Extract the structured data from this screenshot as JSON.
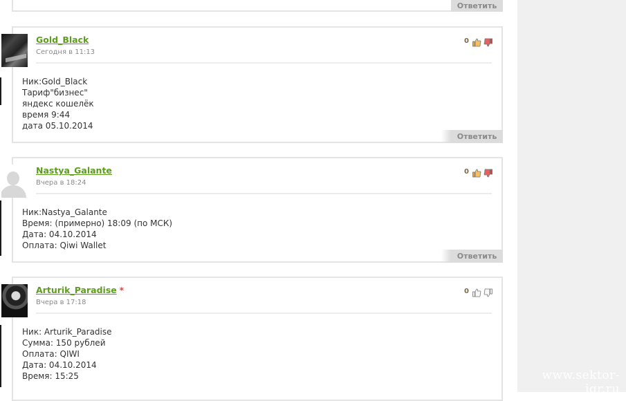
{
  "watermark": "www.sektor-igr.ru",
  "top_partial": {
    "reply_label": "Ответить"
  },
  "comments": [
    {
      "author": "Gold_Black",
      "time": "Сегодня в 11:13",
      "rating": "0",
      "has_star": false,
      "avatar": "dark-artwork-avatar",
      "lines": [
        "Ник:Gold_Black",
        "Тариф\"бизнес\"",
        "яндекс кошелёк",
        "время 9:44",
        "дата 05.10.2014"
      ],
      "reply_label": "Ответить"
    },
    {
      "author": "Nastya_Galante",
      "time": "Вчера в 18:24",
      "rating": "0",
      "has_star": false,
      "avatar": "default-silhouette-avatar",
      "lines": [
        "Ник:Nastya_Galante",
        "Время: (примерно) 18:09 (по МСК)",
        "Дата: 04.10.2014",
        "Оплата: Qiwi Wallet"
      ],
      "reply_label": "Ответить"
    },
    {
      "author": "Arturik_Paradise",
      "author_star": "*",
      "time": "Вчера в 17:18",
      "rating": "0",
      "has_star": true,
      "avatar": "dark-photo-avatar",
      "lines": [
        "Ник: Arturik_Paradise",
        "Сумма: 150 рублей",
        "Оплата: QIWI",
        "Дата: 04.10.2014",
        "Время: 15:25"
      ],
      "reply_label": "Ответить"
    }
  ],
  "colors": {
    "author_link": "#5c9e1b",
    "star": "#e04040",
    "card_border": "#e4e4e4",
    "reply_button_bg": "#dcdcdc",
    "right_panel": "#f0f0f0"
  }
}
